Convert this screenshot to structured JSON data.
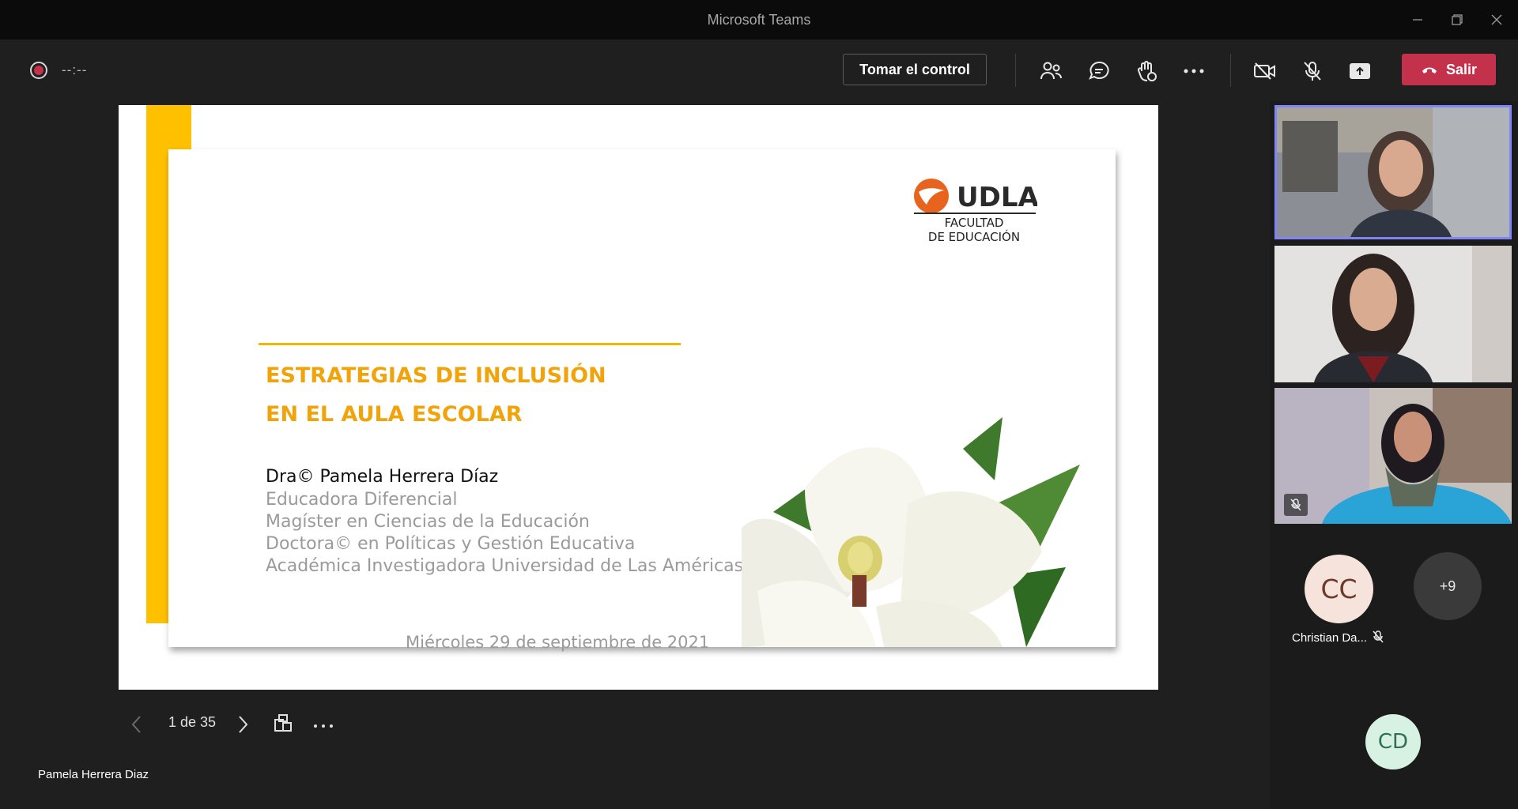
{
  "window": {
    "title": "Microsoft Teams"
  },
  "toolbar": {
    "timer": "--:--",
    "take_control_label": "Tomar el control",
    "leave_label": "Salir",
    "accent_leave": "#c4314b"
  },
  "slide": {
    "logo_brand": "UDLA",
    "logo_faculty_line1": "FACULTAD",
    "logo_faculty_line2": "DE EDUCACIÓN",
    "title_line1": "ESTRATEGIAS DE INCLUSIÓN",
    "title_line2": "EN EL AULA ESCOLAR",
    "author": "Dra© Pamela Herrera Díaz",
    "credentials": [
      "Educadora Diferencial",
      "Magíster en Ciencias de la Educación",
      "Doctora© en Políticas y Gestión Educativa",
      "Académica Investigadora Universidad de Las Américas"
    ],
    "date": "Miércoles 29 de septiembre de 2021",
    "accent": "#f0a30a",
    "stripe_color": "#ffc000"
  },
  "slide_controls": {
    "page_indicator": "1 de 35"
  },
  "presenter_name": "Pamela Herrera Diaz",
  "participants": {
    "overflow_count": "+9",
    "cc_initials": "CC",
    "cc_name": "Christian Da...",
    "cd_initials": "CD"
  }
}
